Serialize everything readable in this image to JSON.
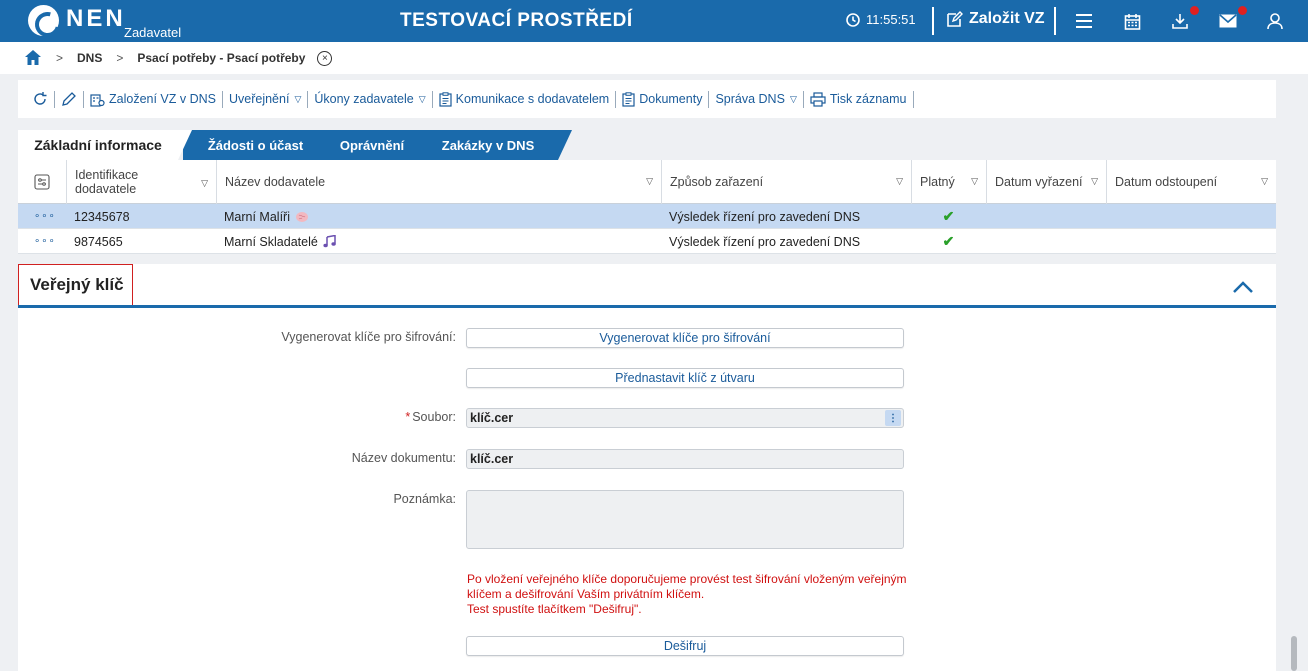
{
  "topbar": {
    "logo": "NEN",
    "logo_sub": "Zadavatel",
    "env_title": "TESTOVACÍ PROSTŘEDÍ",
    "time": "11:55:51",
    "create_label": "Založit VZ",
    "icons": [
      "menu-icon",
      "calendar-icon",
      "download-icon",
      "mail-icon",
      "user-icon"
    ]
  },
  "breadcrumb": {
    "items": [
      "DNS",
      "Psací potřeby - Psací potřeby"
    ],
    "close": "×"
  },
  "toolbar": {
    "items": [
      "Založení VZ v DNS",
      "Uveřejnění",
      "Úkony zadavatele",
      "Komunikace s dodavatelem",
      "Dokumenty",
      "Správa DNS",
      "Tisk záznamu"
    ]
  },
  "tabs": [
    "Základní informace",
    "Žádosti o účast",
    "Oprávnění",
    "Zakázky v DNS"
  ],
  "grid": {
    "columns": [
      "Identifikace dodavatele",
      "Název dodavatele",
      "Způsob zařazení",
      "Platný",
      "Datum vyřazení",
      "Datum odstoupení"
    ],
    "rows": [
      {
        "id": "12345678",
        "name": "Marní Malíři",
        "method": "Výsledek řízení pro zavedení DNS",
        "valid": "✔",
        "selected": true
      },
      {
        "id": "9874565",
        "name": "Marní Skladatelé",
        "method": "Výsledek řízení pro zavedení DNS",
        "valid": "✔",
        "selected": false
      }
    ],
    "row_menu": "∘∘∘"
  },
  "section": {
    "title": "Veřejný klíč",
    "generate_label": "Vygenerovat klíče pro šifrování:",
    "generate_button": "Vygenerovat klíče pro šifrování",
    "preset_button": "Přednastavit klíč z útvaru",
    "file_label": "Soubor:",
    "file_value": "klíč.cer",
    "docname_label": "Název dokumentu:",
    "docname_value": "klíč.cer",
    "note_label": "Poznámka:",
    "warning_line1": "Po vložení veřejného klíče doporučujeme provést test šifrování vloženým veřejným klíčem a dešifrování Vaším privátním klíčem.",
    "warning_line2": "Test spustíte tlačítkem \"Dešifruj\".",
    "decrypt_button": "Dešifruj"
  },
  "colors": {
    "brand": "#1a6aab",
    "selected_row": "#c5d9f2",
    "warning": "#d01010",
    "check": "#2aa02a"
  }
}
